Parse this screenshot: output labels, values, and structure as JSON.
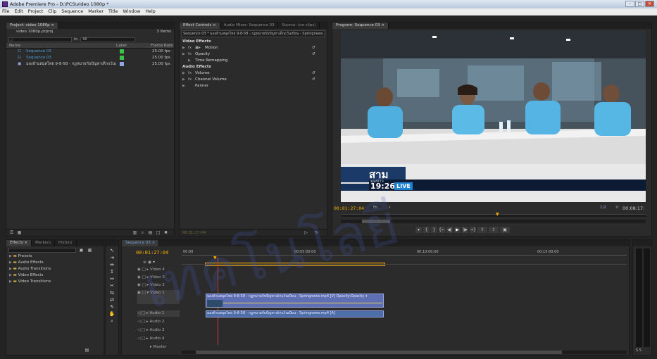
{
  "window": {
    "title": "Adobe Premiere Pro - D:\\PCS\\video 1080p *",
    "min": "–",
    "max": "□",
    "close": "✕"
  },
  "menu": [
    "File",
    "Edit",
    "Project",
    "Clip",
    "Sequence",
    "Marker",
    "Title",
    "Window",
    "Help"
  ],
  "project": {
    "tabs": [
      "Project: video 1080p ×"
    ],
    "name": "video 1080p.prproj",
    "count": "3 Items",
    "in_label": "In:",
    "in_value": "All",
    "columns": {
      "name": "Name",
      "label": "Label",
      "rate": "Frame Rate"
    },
    "items": [
      {
        "name": "Sequence 03",
        "rate": "25.00 fps",
        "color": "#3cc34a"
      },
      {
        "name": "Sequence 03",
        "rate": "25.00 fps",
        "color": "#3cc34a"
      },
      {
        "name": "มองย้ามสมุดไทย 9-8-58 - กฏหมายกับปัญหาเด็กแว้นเบียน",
        "rate": "25.00 fps",
        "color": "#8fa6e0"
      }
    ]
  },
  "effect_controls": {
    "tabs": [
      "Effect Controls ×",
      "Audio Mixer: Sequence 03",
      "Source: (no clips)"
    ],
    "sequence_label": "Sequence 03 * มองย้ามสมุดไทย 9-8-58 - กฏหมายกับปัญหาเด็กแว้นเบียน - Springnews...",
    "video_header": "Video Effects",
    "video_effects": [
      "Motion",
      "Opacity",
      "Time Remapping"
    ],
    "audio_header": "Audio Effects",
    "audio_effects": [
      "Volume",
      "Channel Volume",
      "Panner"
    ],
    "timecode": "00:01:27:04"
  },
  "program": {
    "tabs": [
      "Program: Sequence 03 ×"
    ],
    "lower_third_logo": "สาม",
    "lower_third_sub": "มุมข่าว",
    "clock": "19:26",
    "live": "LIVE",
    "timecode": "00:01:27:04",
    "fit": "Fit",
    "resolution": "1/2",
    "duration": "00:08:17:"
  },
  "effects_panel": {
    "tabs": [
      "Effects ×",
      "Markers",
      "History"
    ],
    "folders": [
      "Presets",
      "Audio Effects",
      "Audio Transitions",
      "Video Effects",
      "Video Transitions"
    ]
  },
  "timeline": {
    "tab": "Sequence 03 ×",
    "timecode": "00:01:27:04",
    "ruler": [
      "00:00",
      "00:05:00:00",
      "00:10:00:00",
      "00:15:00:00"
    ],
    "video_tracks": [
      "Video 4",
      "Video 3",
      "Video 2",
      "Video 1"
    ],
    "audio_tracks": [
      "Audio 1",
      "Audio 2",
      "Audio 3",
      "Audio 4"
    ],
    "master": "Master",
    "video_clip": "มองย้ามสมุดไทย 9-8-58 - กฏหมายกับปัญหาเด็กแว้นเบียน - Springnews.mp4 [V]  Opacity:Opacity ▾",
    "audio_clip": "มองย้ามสมุดไทย 9-8-58 - กฏหมายกับปัญหาเด็กแว้นเบียน - Springnews.mp4 [A]"
  },
  "watermark": "เทคโนโลยี",
  "colors": {
    "accent": "#f7b000",
    "clip_video": "#5f6fb3",
    "live": "#1f7fd0"
  }
}
